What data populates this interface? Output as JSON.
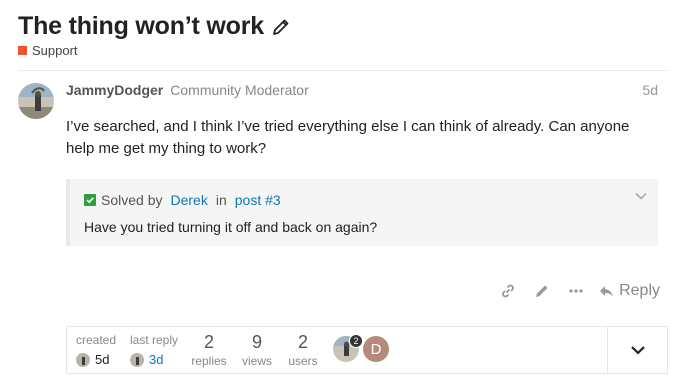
{
  "topic": {
    "title": "The thing won’t work",
    "category": "Support",
    "category_color": "#f0542e"
  },
  "post": {
    "username": "JammyDodger",
    "user_title": "Community Moderator",
    "date": "5d",
    "body": "I’ve searched, and I think I’ve tried everything else I can think of already. Can anyone help me get my thing to work?"
  },
  "solution": {
    "solved_by_label": "Solved by",
    "solver": "Derek",
    "in_label": "in",
    "post_link": "post #3",
    "quote": "Have you tried turning it off and back on again?",
    "check_color": "#2e9e3f"
  },
  "actions": {
    "reply_label": "Reply",
    "icons": [
      "link-icon",
      "pencil-icon",
      "more-dots-icon",
      "reply-arrow-icon"
    ]
  },
  "footer": {
    "created_label": "created",
    "created_value": "5d",
    "last_reply_label": "last reply",
    "last_reply_value": "3d",
    "replies_count": "2",
    "replies_label": "replies",
    "views_count": "9",
    "views_label": "views",
    "users_count": "2",
    "users_label": "users",
    "avatar_badge": "2",
    "second_user_initial": "D",
    "second_user_color": "#b58a7c"
  },
  "colors": {
    "link": "#0f76b8",
    "muted": "#888888"
  }
}
